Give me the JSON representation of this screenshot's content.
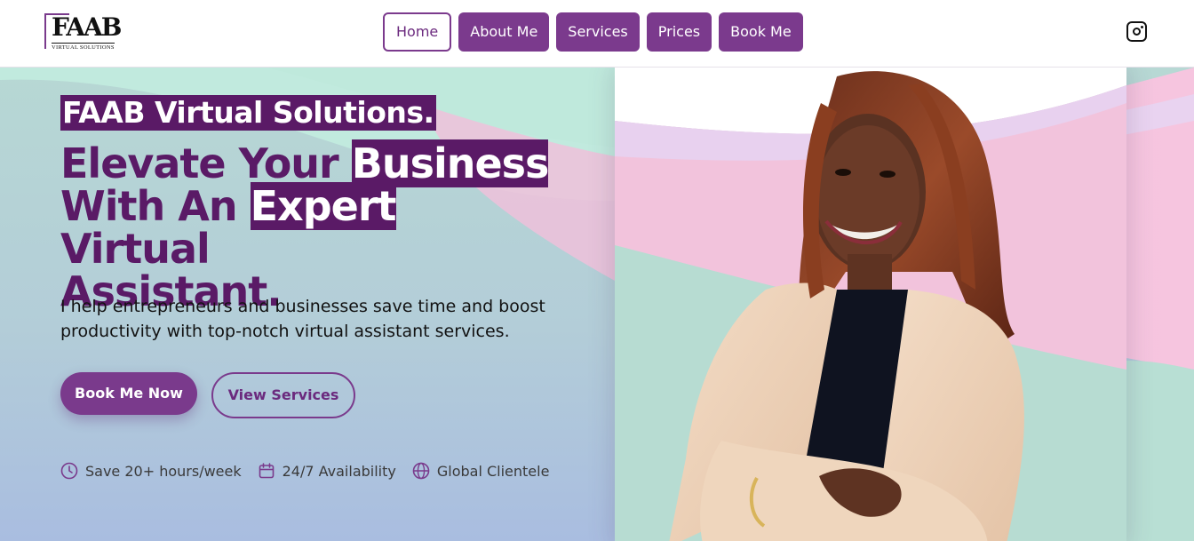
{
  "header": {
    "logo": {
      "wordmark": "FAAB",
      "tagline": "VIRTUAL SOLUTIONS"
    },
    "nav": [
      {
        "label": "Home",
        "active": true
      },
      {
        "label": "About Me",
        "active": false
      },
      {
        "label": "Services",
        "active": false
      },
      {
        "label": "Prices",
        "active": false
      },
      {
        "label": "Book Me",
        "active": false
      }
    ],
    "social_icon": "instagram-icon"
  },
  "hero": {
    "brand": "FAAB Virtual Solutions.",
    "headline": {
      "line1_a": "Elevate Your ",
      "line1_b": "Business",
      "line2_a": "With An ",
      "line2_b": "Expert",
      "line2_c": " Virtual",
      "line3": "Assistant."
    },
    "subtext": "I help entrepreneurs and businesses save time and boost productivity with top-notch virtual assistant services.",
    "primary_cta": "Book Me Now",
    "secondary_cta": "View Services",
    "features": [
      {
        "icon": "clock-icon",
        "label": "Save 20+ hours/week"
      },
      {
        "icon": "calendar-icon",
        "label": "24/7 Availability"
      },
      {
        "icon": "globe-icon",
        "label": "Global Clientele"
      }
    ]
  },
  "colors": {
    "brand_purple": "#7b3a8d",
    "dark_purple": "#5a1a66",
    "mint": "#b7e6d9",
    "pink": "#f4c3dd",
    "lavender": "#e6cfee"
  }
}
